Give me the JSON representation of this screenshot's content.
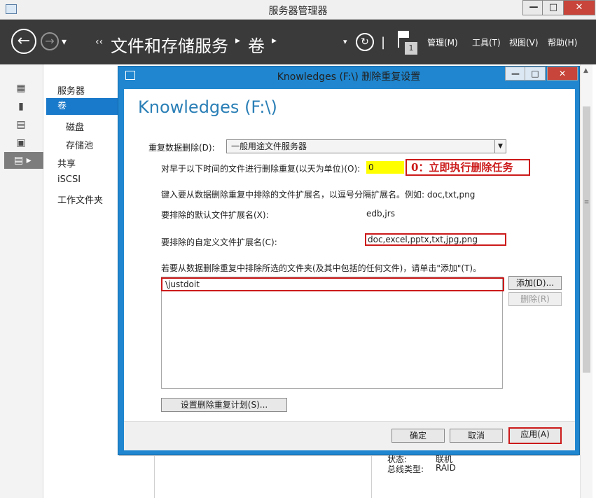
{
  "app": {
    "title": "服务器管理器",
    "window_controls": [
      "—",
      "□",
      "✕"
    ]
  },
  "nav": {
    "back_icon": "arrow-left-icon",
    "forward_icon": "arrow-right-icon",
    "breadcrumb_prefix": "‹‹",
    "crumbs": [
      "文件和存储服务",
      "卷"
    ],
    "flag_count": "1",
    "menus": [
      "管理(M)",
      "工具(T)",
      "视图(V)",
      "帮助(H)"
    ]
  },
  "sidebar": {
    "items": [
      {
        "label": "服务器"
      },
      {
        "label": "卷"
      },
      {
        "label": "磁盘"
      },
      {
        "label": "存储池"
      },
      {
        "label": "共享"
      },
      {
        "label": "iSCSI"
      },
      {
        "label": "工作文件夹"
      }
    ]
  },
  "background": {
    "status_label": "状态:",
    "status_value": "联机",
    "bus_label": "总线类型:",
    "bus_value": "RAID"
  },
  "dialog": {
    "title": "Knowledges (F:\\) 删除重复设置",
    "controls": [
      "—",
      "□",
      "✕"
    ],
    "heading": "Knowledges (F:\\)",
    "dedup_label": "重复数据删除(D):",
    "dedup_value": "一般用途文件服务器",
    "age_label": "对早于以下时间的文件进行删除重复(以天为单位)(O):",
    "age_value": "0",
    "annotation": "0：立即执行删除任务",
    "exclude_hint": "键入要从数据删除重复中排除的文件扩展名，以逗号分隔扩展名。例如: doc,txt,png",
    "default_ext_label": "要排除的默认文件扩展名(X):",
    "default_ext_value": "edb,jrs",
    "custom_ext_label": "要排除的自定义文件扩展名(C):",
    "custom_ext_value": "doc,excel,pptx,txt,jpg,png",
    "folders_hint": "若要从数据删除重复中排除所选的文件夹(及其中包括的任何文件)，请单击\"添加\"(T)。",
    "folders": [
      "\\justdoit"
    ],
    "add_button": "添加(D)...",
    "remove_button": "删除(R)",
    "schedule_button": "设置删除重复计划(S)...",
    "ok_button": "确定",
    "cancel_button": "取消",
    "apply_button": "应用(A)"
  },
  "colors": {
    "accent": "#1f86cf",
    "selected": "#1979ca",
    "annotation": "#cc1a1a",
    "highlight": "#ffff00",
    "nav_bg": "#3a3a3a"
  }
}
